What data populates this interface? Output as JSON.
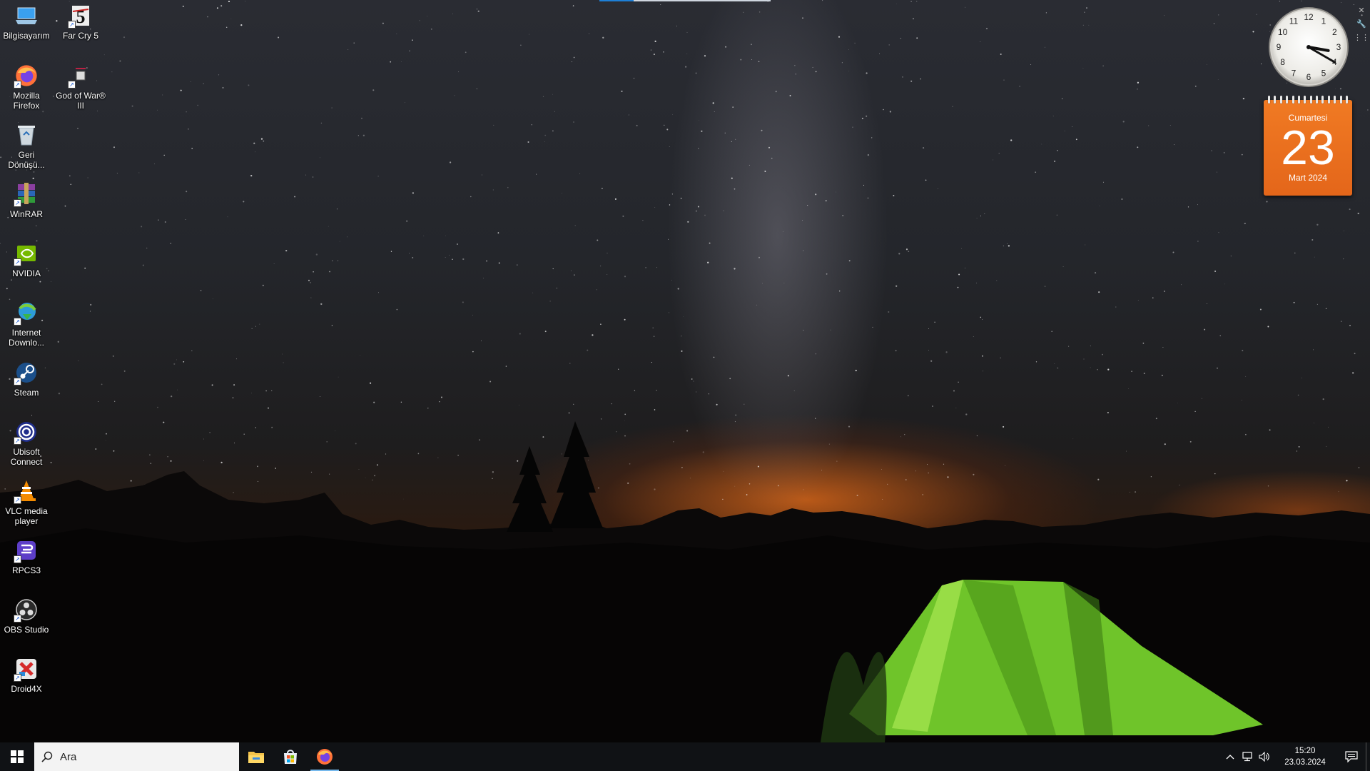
{
  "desktop": {
    "icons": [
      {
        "id": "bilgisayarim",
        "label": "Bilgisayarım",
        "icon": "computer-icon"
      },
      {
        "id": "far-cry-5",
        "label": "Far Cry 5",
        "icon": "far-cry-5-icon"
      },
      {
        "id": "mozilla-firefox",
        "label": "Mozilla Firefox",
        "icon": "firefox-icon"
      },
      {
        "id": "god-of-war",
        "label": "God of War® III",
        "icon": "god-of-war-icon"
      },
      {
        "id": "geri-donusum",
        "label": "Geri Dönüşü...",
        "icon": "recycle-bin-icon"
      },
      {
        "id": "winrar",
        "label": "WinRAR",
        "icon": "winrar-icon"
      },
      {
        "id": "nvidia",
        "label": "NVIDIA",
        "icon": "nvidia-icon"
      },
      {
        "id": "internet-download",
        "label": "Internet Downlo...",
        "icon": "internet-download-manager-icon"
      },
      {
        "id": "steam",
        "label": "Steam",
        "icon": "steam-icon"
      },
      {
        "id": "ubisoft-connect",
        "label": "Ubisoft Connect",
        "icon": "ubisoft-icon"
      },
      {
        "id": "vlc",
        "label": "VLC media player",
        "icon": "vlc-icon"
      },
      {
        "id": "rpcs3",
        "label": "RPCS3",
        "icon": "rpcs3-icon"
      },
      {
        "id": "obs-studio",
        "label": "OBS Studio",
        "icon": "obs-icon"
      },
      {
        "id": "droid4x",
        "label": "Droid4X",
        "icon": "droid4x-icon"
      }
    ]
  },
  "gadgets": {
    "clock": {
      "time": "15:20",
      "hour": 3,
      "minute": 20
    },
    "calendar": {
      "day_name": "Cumartesi",
      "day_number": "23",
      "month_year": "Mart 2024",
      "color": "#e96d1f"
    }
  },
  "taskbar": {
    "search_placeholder": "Ara",
    "pinned_apps": [
      {
        "name": "File Explorer",
        "icon": "file-explorer-icon",
        "active": false
      },
      {
        "name": "Microsoft Store",
        "icon": "microsoft-store-icon",
        "active": false
      },
      {
        "name": "Mozilla Firefox",
        "icon": "firefox-icon",
        "active": true
      }
    ],
    "tray": {
      "icons": [
        "chevron-up-icon",
        "network-icon",
        "volume-icon"
      ],
      "time": "15:20",
      "date": "23.03.2024"
    },
    "accent_color": "#76b9ed"
  }
}
